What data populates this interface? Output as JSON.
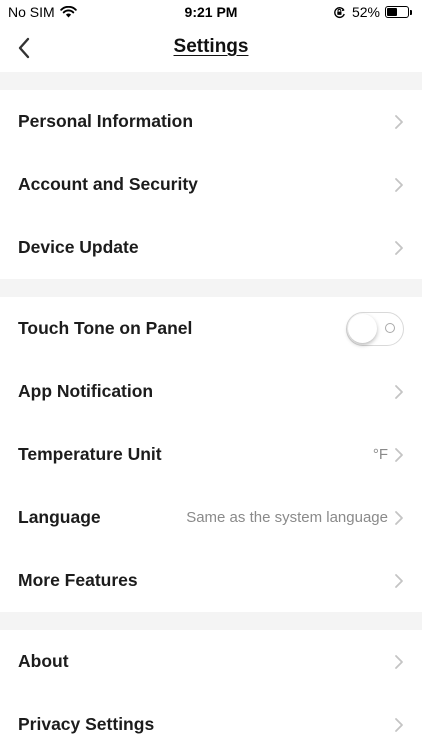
{
  "status_bar": {
    "carrier": "No SIM",
    "time": "9:21 PM",
    "battery_percent": "52%",
    "battery_level": 0.52,
    "icons": [
      "wifi-icon",
      "orientation-lock-icon",
      "battery-icon"
    ]
  },
  "nav": {
    "title": "Settings",
    "back_icon": "chevron-left-icon"
  },
  "sections": [
    {
      "items": [
        {
          "label": "Personal Information",
          "type": "link"
        },
        {
          "label": "Account and Security",
          "type": "link"
        },
        {
          "label": "Device Update",
          "type": "link"
        }
      ]
    },
    {
      "items": [
        {
          "label": "Touch Tone on Panel",
          "type": "toggle",
          "toggle_on": false
        },
        {
          "label": "App Notification",
          "type": "link"
        },
        {
          "label": "Temperature Unit",
          "type": "link",
          "value": "°F"
        },
        {
          "label": "Language",
          "type": "link",
          "value": "Same as the system language"
        },
        {
          "label": "More Features",
          "type": "link"
        }
      ]
    },
    {
      "items": [
        {
          "label": "About",
          "type": "link"
        },
        {
          "label": "Privacy Settings",
          "type": "link"
        }
      ]
    }
  ],
  "colors": {
    "section_gap": "#f4f4f4",
    "label": "#1c1c1c",
    "value": "#8a8a8a",
    "chevron": "#c4c4c4"
  }
}
